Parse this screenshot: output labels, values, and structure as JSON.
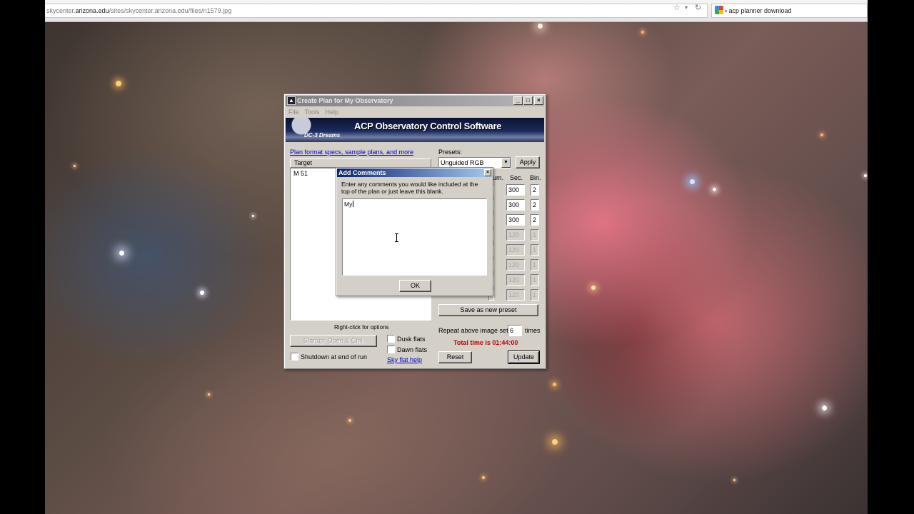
{
  "browser": {
    "url_domain": "skycenter.arizona.edu",
    "url_prefix": "skycenter.",
    "url_rest": "/sites/skycenter.arizona.edu/files/n1579.jpg",
    "search_text": "acp planner download"
  },
  "app": {
    "title": "Create Plan for My Observatory",
    "menu": [
      "File",
      "Tools",
      "Help"
    ],
    "banner_title": "ACP Observatory Control Software",
    "banner_brand": "DC-3 Dreams",
    "plan_link": "Plan format specs, sample plans, and more",
    "target_header": "Target",
    "targets": [
      "M 51"
    ],
    "presets_label": "Presets:",
    "preset_value": "Unguided RGB",
    "apply_label": "Apply",
    "col_num": "um.",
    "col_sec": "Sec.",
    "col_bin": "Bin.",
    "rows": [
      {
        "sec": "300",
        "bin": "2",
        "enabled": true
      },
      {
        "sec": "300",
        "bin": "2",
        "enabled": true
      },
      {
        "sec": "300",
        "bin": "2",
        "enabled": true
      },
      {
        "sec": "120",
        "bin": "1",
        "enabled": false
      },
      {
        "sec": "120",
        "bin": "1",
        "enabled": false
      },
      {
        "sec": "120",
        "bin": "1",
        "enabled": false
      },
      {
        "sec": "120",
        "bin": "1",
        "enabled": false
      },
      {
        "sec": "120",
        "bin": "1",
        "enabled": false
      }
    ],
    "save_preset_label": "Save as new preset",
    "right_click_hint": "Right-click for options",
    "repeat_label": "Repeat above image set",
    "repeat_value": "6",
    "repeat_unit": "times",
    "total_time": "Total time is 01:44:00",
    "startup_label": "Startup: Open & Chill",
    "dusk_flats": "Dusk flats",
    "dawn_flats": "Dawn flats",
    "sky_flat_help": "Sky flat help",
    "shutdown_label": "Shutdown at end of run",
    "reset_label": "Reset",
    "update_label": "Update"
  },
  "dialog": {
    "title": "Add Comments",
    "instructions": "Enter any comments you would like included at the top of the plan or just leave this blank.",
    "comment_value": "My",
    "ok_label": "OK"
  },
  "colors": {
    "total_time": "#c00000",
    "link": "#0000cc",
    "dialog_title_start": "#0a246a"
  }
}
